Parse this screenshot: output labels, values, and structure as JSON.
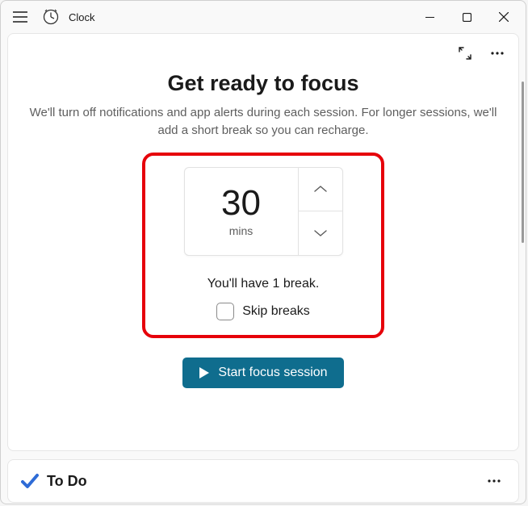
{
  "app": {
    "title": "Clock"
  },
  "focus": {
    "heading": "Get ready to focus",
    "description": "We'll turn off notifications and app alerts during each session. For longer sessions, we'll add a short break so you can recharge.",
    "duration_value": "30",
    "duration_unit": "mins",
    "break_text": "You'll have 1 break.",
    "skip_breaks_label": "Skip breaks",
    "start_button": "Start focus session"
  },
  "todo": {
    "title": "To Do"
  },
  "colors": {
    "accent": "#0f6d8e",
    "highlight_border": "#e6000a"
  }
}
